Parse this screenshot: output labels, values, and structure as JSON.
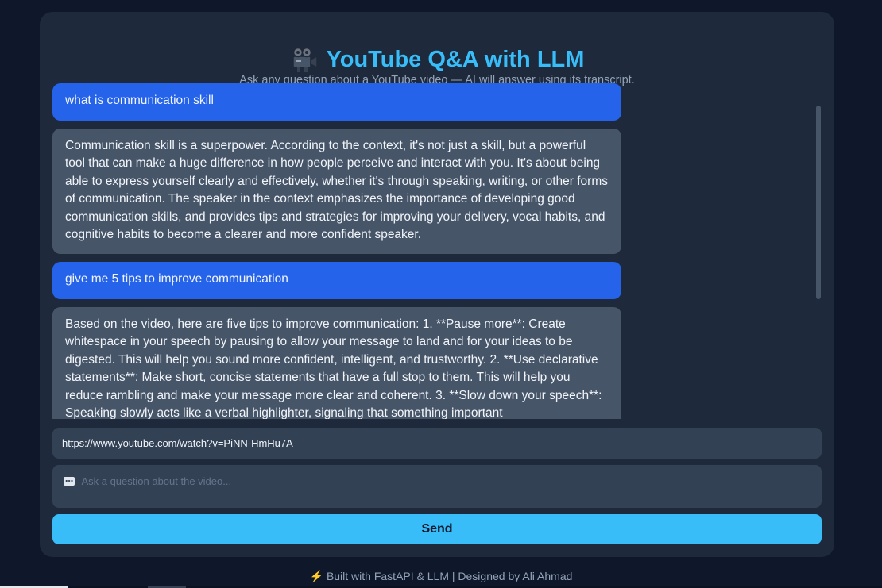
{
  "header": {
    "title": "YouTube Q&A with LLM",
    "subtitle": "Ask any question about a YouTube video — AI will answer using its transcript."
  },
  "messages": [
    {
      "role": "user",
      "text": "what is communication skill"
    },
    {
      "role": "bot",
      "text": "Communication skill is a superpower. According to the context, it's not just a skill, but a powerful tool that can make a huge difference in how people perceive and interact with you. It's about being able to express yourself clearly and effectively, whether it's through speaking, writing, or other forms of communication. The speaker in the context emphasizes the importance of developing good communication skills, and provides tips and strategies for improving your delivery, vocal habits, and cognitive habits to become a clearer and more confident speaker."
    },
    {
      "role": "user",
      "text": "give me 5 tips to improve communication"
    },
    {
      "role": "bot",
      "text": "Based on the video, here are five tips to improve communication: 1. **Pause more**: Create whitespace in your speech by pausing to allow your message to land and for your ideas to be digested. This will help you sound more confident, intelligent, and trustworthy. 2. **Use declarative statements**: Make short, concise statements that have a full stop to them. This will help you reduce rambling and make your message more clear and coherent. 3. **Slow down your speech**: Speaking slowly acts like a verbal highlighter, signaling that something important"
    }
  ],
  "inputs": {
    "url_value": "https://www.youtube.com/watch?v=PiNN-HmHu7A",
    "question_placeholder": "Ask a question about the video..."
  },
  "actions": {
    "send_label": "Send"
  },
  "footer": {
    "bolt": "⚡",
    "text": "Built with FastAPI & LLM | Designed by Ali Ahmad"
  },
  "colors": {
    "accent": "#38bdf8",
    "user_bubble": "#2563eb",
    "bot_bubble": "#475569",
    "card": "#1e293b",
    "background": "#0f172a"
  },
  "icons": {
    "title_icon": "movie-camera-icon",
    "question_icon": "speech-bubble-icon",
    "footer_icon": "lightning-icon"
  }
}
